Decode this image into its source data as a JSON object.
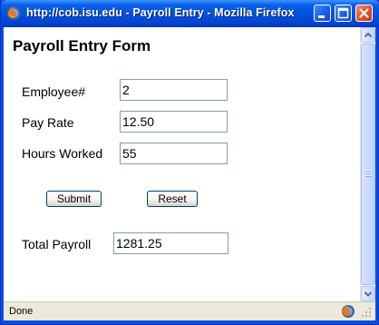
{
  "window": {
    "title": "http://cob.isu.edu - Payroll Entry - Mozilla Firefox"
  },
  "form": {
    "heading": "Payroll Entry Form",
    "employee_label": "Employee#",
    "employee_value": "2",
    "payrate_label": "Pay Rate",
    "payrate_value": "12.50",
    "hours_label": "Hours Worked",
    "hours_value": "55",
    "submit_label": "Submit",
    "reset_label": "Reset",
    "total_label": "Total Payroll",
    "total_value": "1281.25"
  },
  "status": {
    "text": "Done"
  },
  "icons": {
    "app": "firefox-icon",
    "minimize": "minimize-icon",
    "maximize": "maximize-icon",
    "close": "close-icon"
  },
  "colors": {
    "titlebar": "#0452e0",
    "close_button": "#e2542f",
    "field_border": "#7f9db9",
    "status_bar": "#ece9d8"
  }
}
